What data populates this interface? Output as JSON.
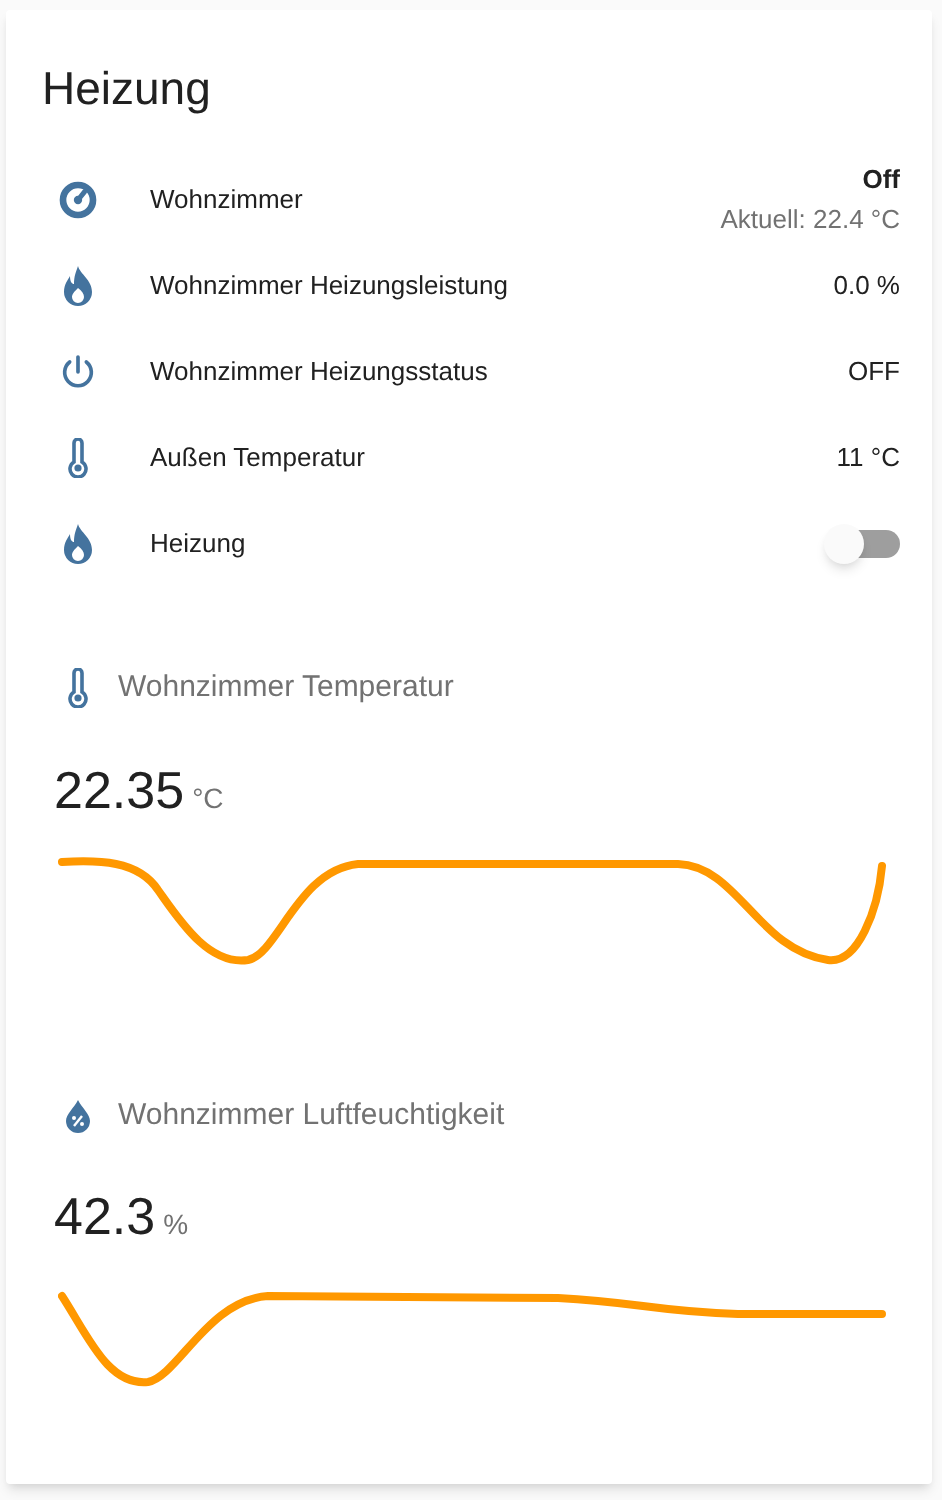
{
  "card": {
    "title": "Heizung"
  },
  "entities": [
    {
      "kind": "climate",
      "name": "Wohnzimmer",
      "state": "Off",
      "sub": "Aktuell: 22.4 °C"
    },
    {
      "kind": "sensor",
      "name": "Wohnzimmer Heizungsleistung",
      "state": "0.0 %"
    },
    {
      "kind": "sensor",
      "name": "Wohnzimmer Heizungsstatus",
      "state": "OFF"
    },
    {
      "kind": "sensor",
      "name": "Außen Temperatur",
      "state": "11 °C"
    },
    {
      "kind": "toggle",
      "name": "Heizung",
      "on": false
    }
  ],
  "sensors": [
    {
      "name": "Wohnzimmer Temperatur",
      "value": "22.35",
      "unit": "°C"
    },
    {
      "name": "Wohnzimmer Luftfeuchtigkeit",
      "value": "42.3",
      "unit": "%"
    }
  ]
}
